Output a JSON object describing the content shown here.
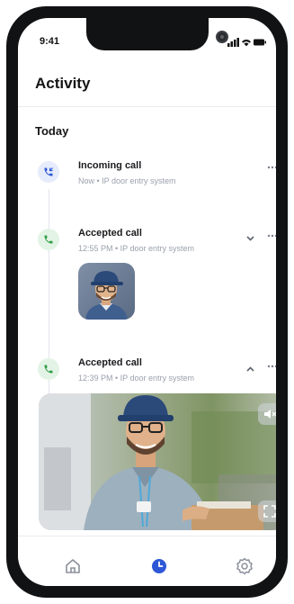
{
  "status_bar": {
    "time": "9:41"
  },
  "header": {
    "title": "Activity"
  },
  "section": {
    "label": "Today"
  },
  "events": [
    {
      "title": "Incoming call",
      "subtitle": "Now • IP door entry system",
      "kind": "incoming",
      "expanded": false
    },
    {
      "title": "Accepted call",
      "subtitle": "12:55 PM • IP door entry system",
      "kind": "accepted",
      "expanded": false
    },
    {
      "title": "Accepted call",
      "subtitle": "12:39 PM • IP door entry system",
      "kind": "accepted",
      "expanded": true
    }
  ],
  "icons": {
    "incoming": "phone-incoming-icon",
    "accepted": "phone-accepted-icon",
    "more": "more-horizontal-icon",
    "expand": "chevron-down-icon",
    "collapse": "chevron-up-icon",
    "mute": "speaker-muted-icon",
    "fullscreen": "fullscreen-icon",
    "home": "home-icon",
    "activity": "clock-icon",
    "settings": "gear-icon"
  },
  "tabs": [
    {
      "id": "home",
      "active": false
    },
    {
      "id": "activity",
      "active": true
    },
    {
      "id": "settings",
      "active": false
    }
  ],
  "colors": {
    "incoming_bg": "#e6ecfb",
    "incoming_fg": "#2d57d6",
    "accepted_bg": "#e3f4e6",
    "accepted_fg": "#2f9e44",
    "accent": "#2d57d6",
    "muted_text": "#9aa0ad",
    "tab_inactive": "#8b909b"
  }
}
